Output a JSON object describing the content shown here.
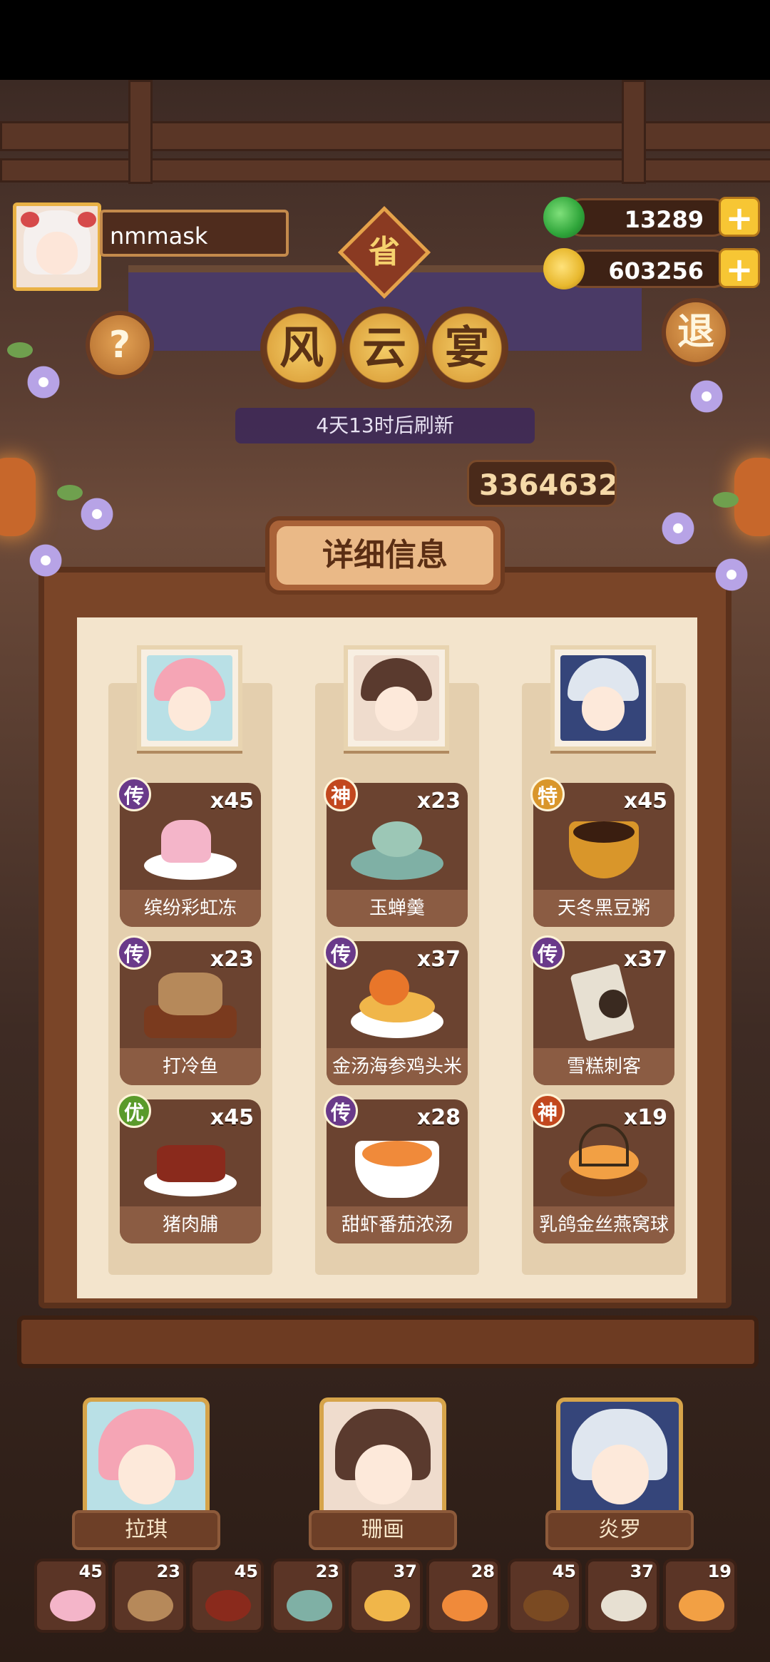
{
  "player": {
    "name": "nmmask"
  },
  "currencies": [
    {
      "name": "jade",
      "icon": "jade-coin-icon",
      "value": "13289",
      "color": "#2fa53a"
    },
    {
      "name": "gold",
      "icon": "gold-coin-icon",
      "value": "603256",
      "color": "#e8b82e"
    }
  ],
  "buttons": {
    "help": "?",
    "exit": "退",
    "plus": "+"
  },
  "province_badge": "省",
  "event_title": [
    "风",
    "云",
    "宴"
  ],
  "refresh_text": "4天13时后刷新",
  "score": "3364632",
  "detail_title": "详细信息",
  "chefs": [
    {
      "name": "拉琪",
      "hair": "#f5a5b5",
      "bg": "#b9e0e6"
    },
    {
      "name": "珊画",
      "hair": "#5a3a2e",
      "bg": "#efdccd"
    },
    {
      "name": "炎罗",
      "hair": "#dfe6ef",
      "bg": "#35457a"
    }
  ],
  "columns": [
    {
      "dishes": [
        {
          "name": "缤纷彩虹冻",
          "count": "x45",
          "grade": "传",
          "grade_color": "#6a3a8a",
          "art": "#f4b5c9"
        },
        {
          "name": "打冷鱼",
          "count": "x23",
          "grade": "传",
          "grade_color": "#6a3a8a",
          "art": "#b6895a"
        },
        {
          "name": "猪肉脯",
          "count": "x45",
          "grade": "优",
          "grade_color": "#5a9a2a",
          "art": "#8a2a1c"
        }
      ]
    },
    {
      "dishes": [
        {
          "name": "玉蝉羹",
          "count": "x23",
          "grade": "神",
          "grade_color": "#c2481e",
          "art": "#7fb0a5"
        },
        {
          "name": "金汤海参鸡头米",
          "count": "x37",
          "grade": "传",
          "grade_color": "#6a3a8a",
          "art": "#f0b64a"
        },
        {
          "name": "甜虾番茄浓汤",
          "count": "x28",
          "grade": "传",
          "grade_color": "#6a3a8a",
          "art": "#f08a3a"
        }
      ]
    },
    {
      "dishes": [
        {
          "name": "天冬黑豆粥",
          "count": "x45",
          "grade": "特",
          "grade_color": "#d9962a",
          "art": "#7a4a22"
        },
        {
          "name": "雪糕刺客",
          "count": "x37",
          "grade": "传",
          "grade_color": "#6a3a8a",
          "art": "#e7e0d2"
        },
        {
          "name": "乳鸽金丝燕窝球",
          "count": "x19",
          "grade": "神",
          "grade_color": "#c2481e",
          "art": "#f2a044"
        }
      ]
    }
  ],
  "tray": [
    {
      "count": "45",
      "color": "#f4b5c9"
    },
    {
      "count": "23",
      "color": "#b6895a"
    },
    {
      "count": "45",
      "color": "#8a2a1c"
    },
    {
      "count": "23",
      "color": "#7fb0a5"
    },
    {
      "count": "37",
      "color": "#f0b64a"
    },
    {
      "count": "28",
      "color": "#f08a3a"
    },
    {
      "count": "45",
      "color": "#7a4a22"
    },
    {
      "count": "37",
      "color": "#e7e0d2"
    },
    {
      "count": "19",
      "color": "#f2a044"
    }
  ]
}
